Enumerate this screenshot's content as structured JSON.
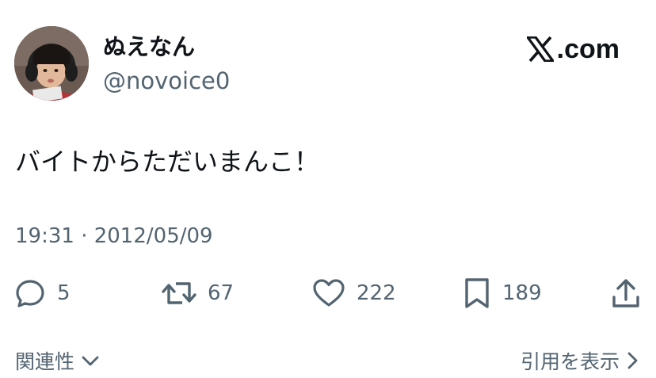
{
  "author": {
    "display_name": "ぬえなん",
    "handle": "@novoice0",
    "avatar": "avatar"
  },
  "brand": {
    "logo_icon": "x-logo-icon",
    "domain_suffix": ".com"
  },
  "tweet": {
    "text": "バイトからただいまんこ！",
    "timestamp": "19:31 · 2012/05/09"
  },
  "actions": {
    "replies": {
      "icon": "reply-icon",
      "count": "5"
    },
    "reposts": {
      "icon": "repost-icon",
      "count": "67"
    },
    "likes": {
      "icon": "heart-icon",
      "count": "222"
    },
    "bookmarks": {
      "icon": "bookmark-icon",
      "count": "189"
    },
    "share": {
      "icon": "share-icon"
    }
  },
  "footer": {
    "related_label": "関連性",
    "quotes_label": "引用を表示"
  },
  "colors": {
    "text_primary": "#0f1419",
    "text_secondary": "#536471",
    "background": "#ffffff"
  }
}
